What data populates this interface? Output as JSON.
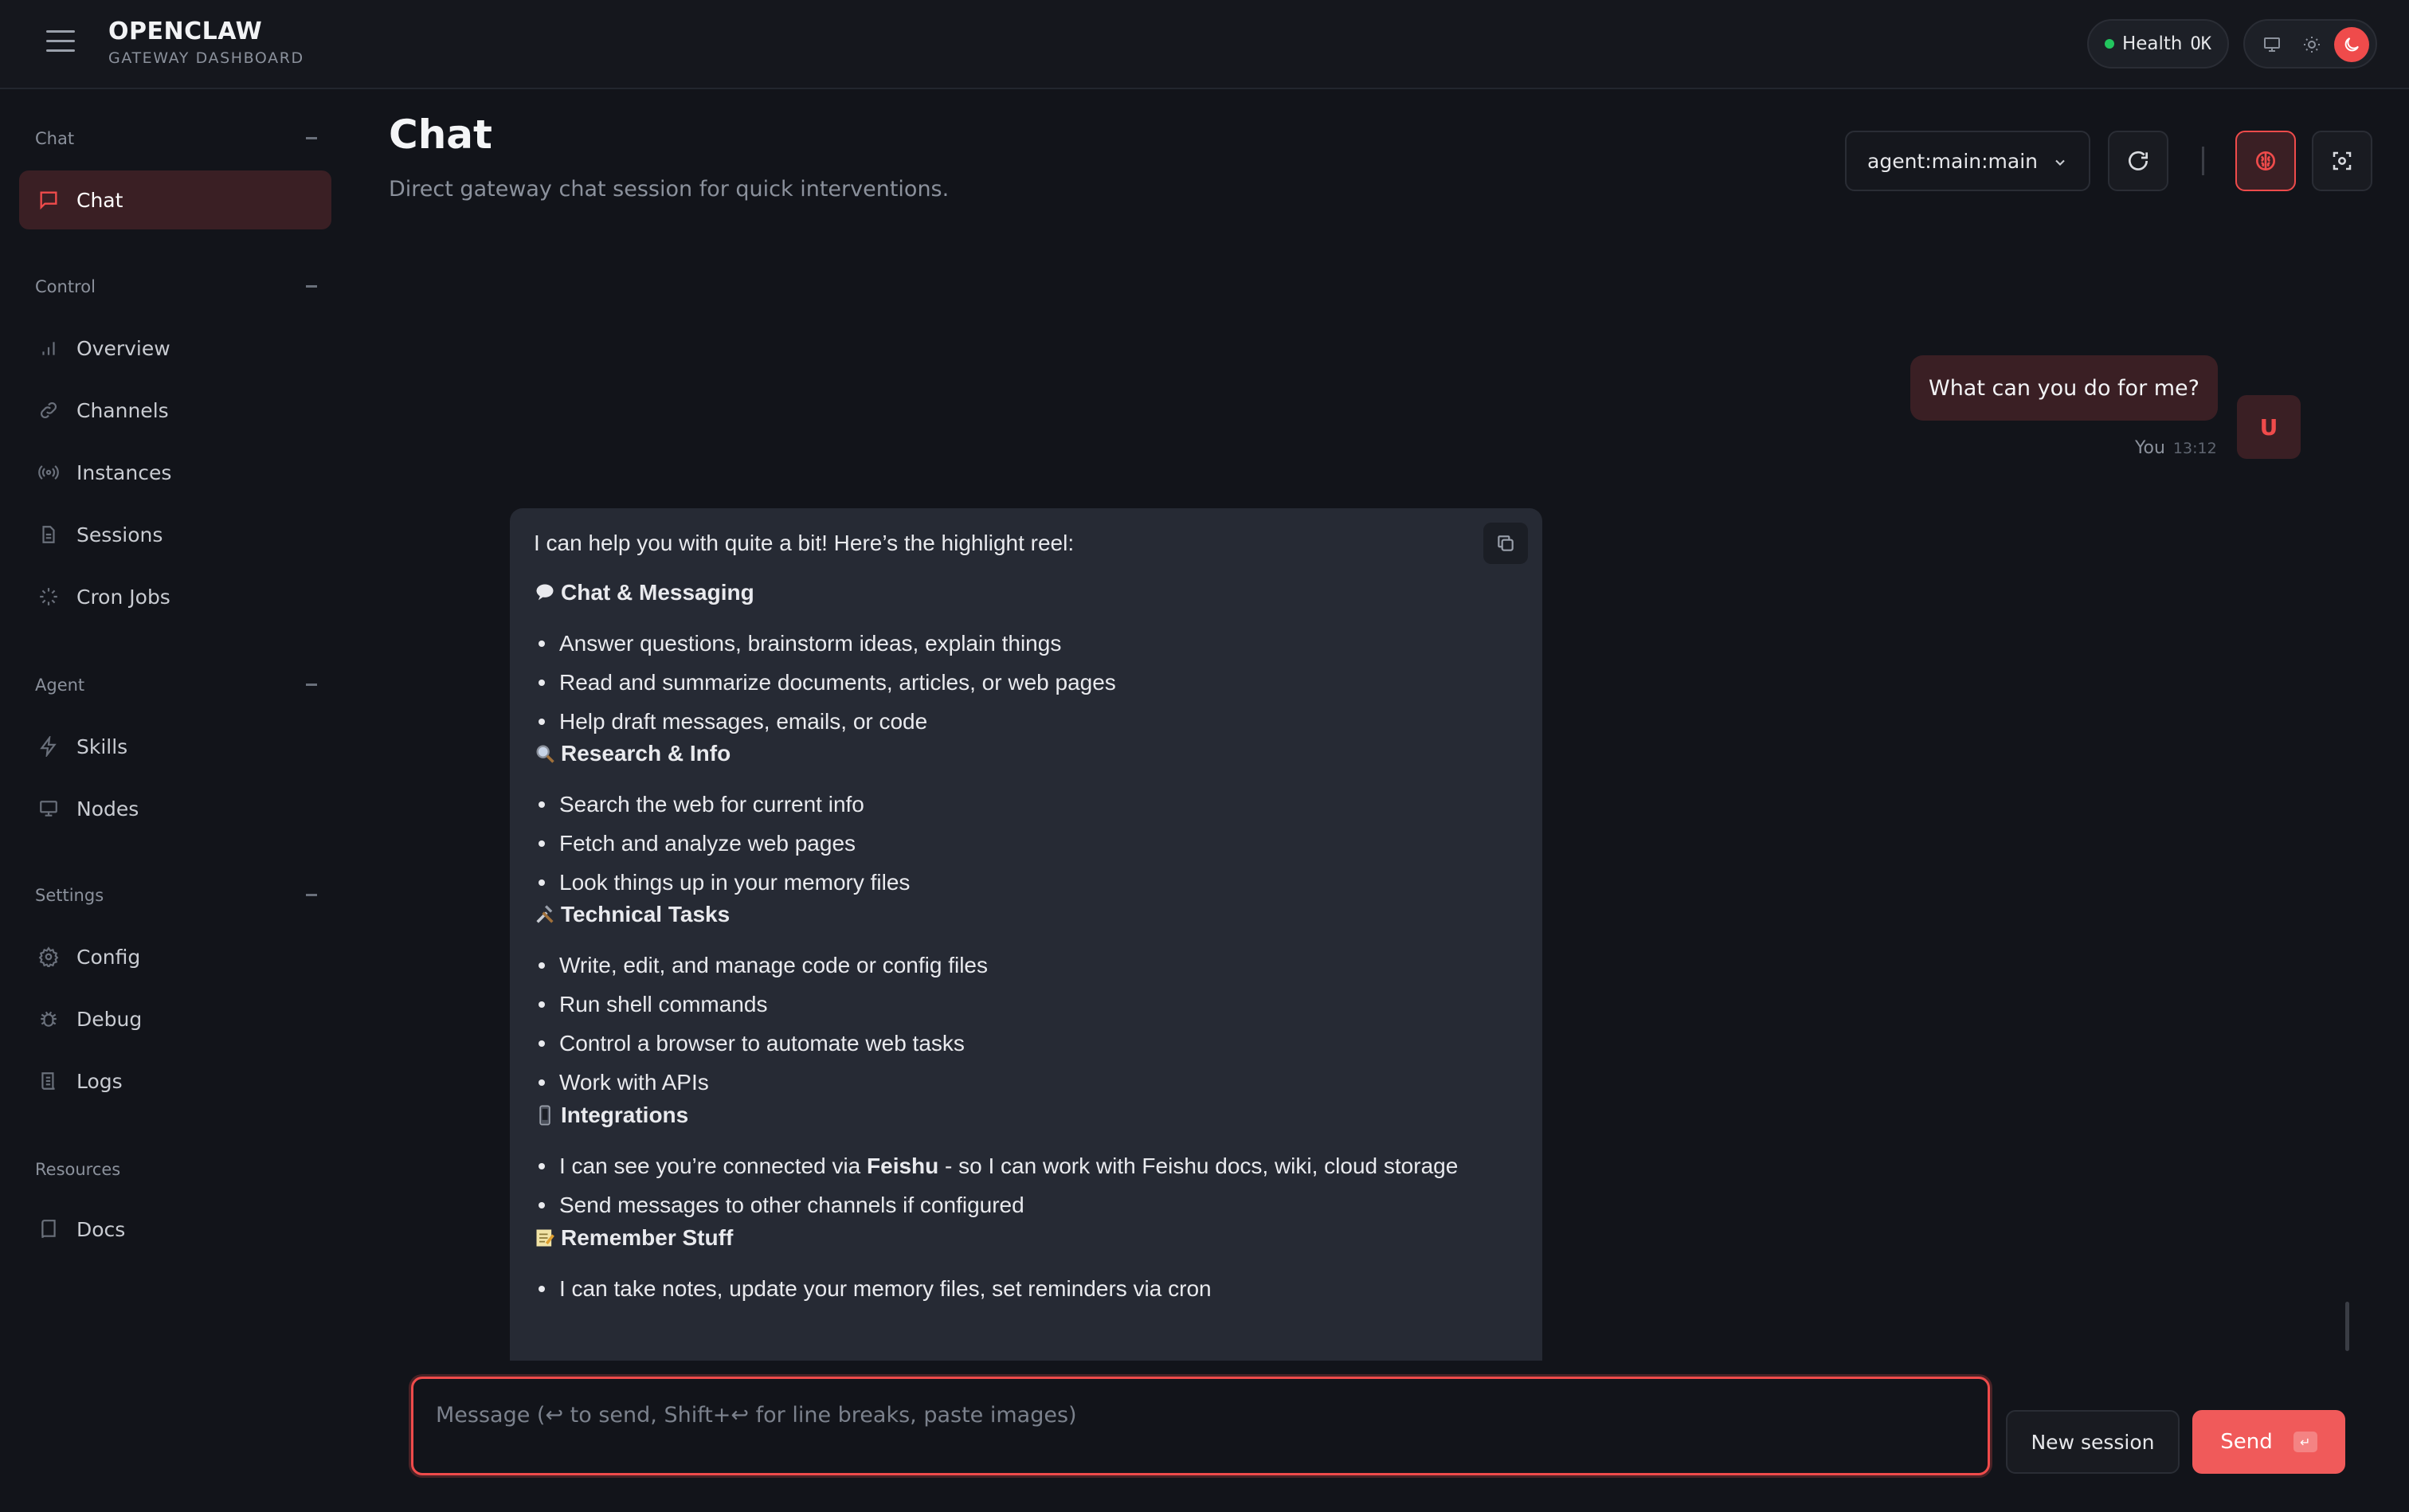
{
  "header": {
    "brand_title": "OPENCLAW",
    "brand_subtitle": "GATEWAY DASHBOARD",
    "health_label": "Health",
    "health_status": "OK",
    "theme_options": [
      "system-icon",
      "sun-icon",
      "moon-icon"
    ],
    "active_theme": "dark"
  },
  "sidebar": {
    "groups": [
      {
        "label": "Chat",
        "items": [
          {
            "label": "Chat",
            "icon": "chat-bubble-icon",
            "active": true
          }
        ]
      },
      {
        "label": "Control",
        "items": [
          {
            "label": "Overview",
            "icon": "bar-chart-icon"
          },
          {
            "label": "Channels",
            "icon": "link-icon"
          },
          {
            "label": "Instances",
            "icon": "radio-signal-icon"
          },
          {
            "label": "Sessions",
            "icon": "document-icon"
          },
          {
            "label": "Cron Jobs",
            "icon": "loader-icon"
          }
        ]
      },
      {
        "label": "Agent",
        "items": [
          {
            "label": "Skills",
            "icon": "lightning-icon"
          },
          {
            "label": "Nodes",
            "icon": "monitor-icon"
          }
        ]
      },
      {
        "label": "Settings",
        "items": [
          {
            "label": "Config",
            "icon": "gear-icon"
          },
          {
            "label": "Debug",
            "icon": "bug-icon"
          },
          {
            "label": "Logs",
            "icon": "scroll-icon"
          }
        ]
      },
      {
        "label": "Resources",
        "items": [
          {
            "label": "Docs",
            "icon": "book-icon"
          }
        ]
      }
    ]
  },
  "main": {
    "title": "Chat",
    "subtitle": "Direct gateway chat session for quick interventions.",
    "agent_select": "agent:main:main"
  },
  "conversation": {
    "user_message": {
      "text": "What can you do for me?",
      "sender": "You",
      "time": "13:12",
      "avatar_letter": "U"
    },
    "assistant_message": {
      "intro": "I can help you with quite a bit! Here’s the highlight reel:",
      "sections": [
        {
          "icon": "speech-bubble-emoji",
          "title": "Chat & Messaging",
          "items": [
            "Answer questions, brainstorm ideas, explain things",
            "Read and summarize documents, articles, or web pages",
            "Help draft messages, emails, or code"
          ]
        },
        {
          "icon": "magnifier-emoji",
          "title": "Research & Info",
          "items": [
            "Search the web for current info",
            "Fetch and analyze web pages",
            "Look things up in your memory files"
          ]
        },
        {
          "icon": "tools-emoji",
          "title": "Technical Tasks",
          "items": [
            "Write, edit, and manage code or config files",
            "Run shell commands",
            "Control a browser to automate web tasks",
            "Work with APIs"
          ]
        },
        {
          "icon": "phone-emoji",
          "title": "Integrations",
          "items": [
            {
              "before": "I can see you’re connected via ",
              "bold": "Feishu",
              "after": " - so I can work with Feishu docs, wiki, cloud storage"
            },
            "Send messages to other channels if configured"
          ]
        },
        {
          "icon": "memo-emoji",
          "title": "Remember Stuff",
          "items": [
            "I can take notes, update your memory files, set reminders via cron"
          ]
        }
      ]
    }
  },
  "composer": {
    "placeholder": "Message (↩ to send, Shift+↩ for line breaks, paste images)",
    "value": "",
    "new_session_label": "New session",
    "send_label": "Send",
    "send_shortcut": "↵"
  },
  "colors": {
    "accent": "#ef4b4b",
    "background": "#12141a",
    "active_nav_bg": "#3a1f24",
    "assistant_bubble": "#262a34",
    "health_dot": "#22c55e"
  }
}
